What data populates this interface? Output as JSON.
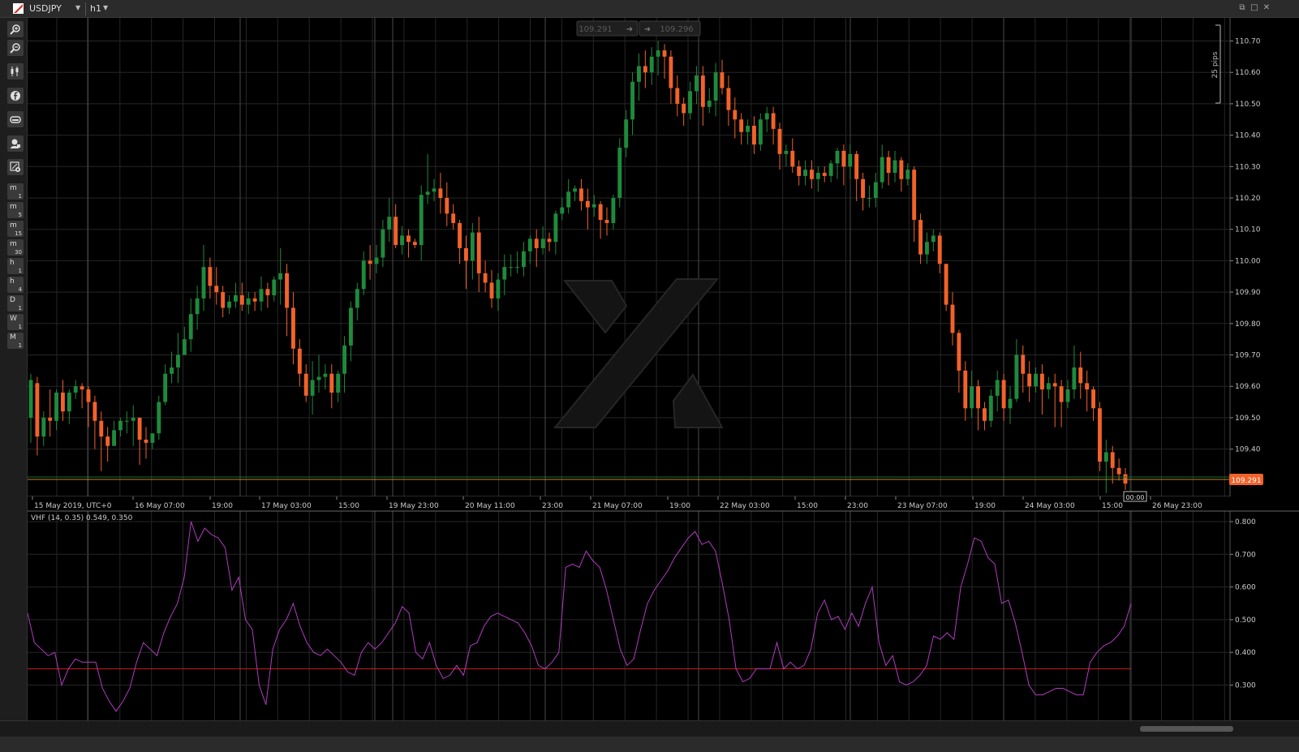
{
  "window": {
    "symbol": "USDJPY",
    "timeframe": "h1"
  },
  "toolbar": {
    "tools": [
      {
        "icon": "zoom-in-icon"
      },
      {
        "icon": "zoom-out-icon"
      },
      {
        "icon": "chart-type-icon"
      },
      {
        "icon": "facebook-icon"
      },
      {
        "icon": "gamepad-icon"
      },
      {
        "icon": "trader-icon"
      },
      {
        "icon": "settings-icon"
      }
    ],
    "timeframes": [
      {
        "main": "m",
        "sub": "1"
      },
      {
        "main": "m",
        "sub": "5"
      },
      {
        "main": "m",
        "sub": "15"
      },
      {
        "main": "m",
        "sub": "30"
      },
      {
        "main": "h",
        "sub": "1"
      },
      {
        "main": "h",
        "sub": "4"
      },
      {
        "main": "D",
        "sub": "1"
      },
      {
        "main": "W",
        "sub": "1"
      },
      {
        "main": "M",
        "sub": "1"
      }
    ]
  },
  "trade": {
    "sell_price": "109.291",
    "buy_price": "109.296"
  },
  "ruler_label": "25 pips",
  "current_price": "109.291",
  "countdown": "00:00",
  "colors": {
    "bull": "#1f8a3c",
    "bear": "#f2622a",
    "vhf": "#b23bc0",
    "level": "#d21e1e",
    "price_line": "#b88a2d",
    "price_tag": "#f2622a"
  },
  "chart_data": [
    {
      "type": "candlestick",
      "title": "USDJPY",
      "ylim": [
        109.25,
        110.74
      ],
      "y_ticks": [
        "110.70",
        "110.60",
        "110.50",
        "110.40",
        "110.30",
        "110.20",
        "110.10",
        "110.00",
        "109.90",
        "109.80",
        "109.70",
        "109.60",
        "109.50",
        "109.40"
      ],
      "x_labels": [
        "15 May 2019, UTC+0",
        "16 May 07:00",
        "19:00",
        "17 May 03:00",
        "15:00",
        "19 May 23:00",
        "20 May 11:00",
        "23:00",
        "21 May 07:00",
        "19:00",
        "22 May 03:00",
        "15:00",
        "23:00",
        "23 May 07:00",
        "19:00",
        "24 May 03:00",
        "15:00",
        "26 May 23:00"
      ],
      "close": [
        109.62,
        109.44,
        109.5,
        109.49,
        109.58,
        109.52,
        109.58,
        109.6,
        109.59,
        109.55,
        109.49,
        109.44,
        109.41,
        109.46,
        109.49,
        109.49,
        109.5,
        109.43,
        109.42,
        109.45,
        109.55,
        109.64,
        109.66,
        109.7,
        109.75,
        109.83,
        109.88,
        109.98,
        109.92,
        109.9,
        109.85,
        109.87,
        109.89,
        109.86,
        109.88,
        109.87,
        109.91,
        109.89,
        109.94,
        109.96,
        109.85,
        109.72,
        109.64,
        109.57,
        109.62,
        109.63,
        109.64,
        109.58,
        109.64,
        109.73,
        109.85,
        109.91,
        110.0,
        109.99,
        110.01,
        110.1,
        110.14,
        110.05,
        110.08,
        110.06,
        110.05,
        110.21,
        110.22,
        110.23,
        110.2,
        110.15,
        110.12,
        110.04,
        110.0,
        110.09,
        109.96,
        109.93,
        109.88,
        109.94,
        109.98,
        109.98,
        109.98,
        110.03,
        110.07,
        110.04,
        110.07,
        110.06,
        110.15,
        110.17,
        110.22,
        110.23,
        110.19,
        110.17,
        110.18,
        110.13,
        110.12,
        110.2,
        110.36,
        110.45,
        110.57,
        110.62,
        110.6,
        110.65,
        110.67,
        110.65,
        110.55,
        110.5,
        110.47,
        110.54,
        110.59,
        110.49,
        110.51,
        110.6,
        110.55,
        110.48,
        110.45,
        110.41,
        110.43,
        110.37,
        110.45,
        110.47,
        110.42,
        110.34,
        110.35,
        110.3,
        110.27,
        110.29,
        110.26,
        110.28,
        110.27,
        110.31,
        110.35,
        110.3,
        110.34,
        110.26,
        110.2,
        110.2,
        110.25,
        110.33,
        110.28,
        110.32,
        110.26,
        110.29,
        110.13,
        110.02,
        110.06,
        110.08,
        109.99,
        109.86,
        109.77,
        109.65,
        109.53,
        109.6,
        109.53,
        109.49,
        109.57,
        109.62,
        109.53,
        109.56,
        109.7,
        109.64,
        109.6,
        109.64,
        109.59,
        109.61,
        109.6,
        109.55,
        109.59,
        109.66,
        109.61,
        109.59,
        109.53,
        109.36,
        109.39,
        109.34,
        109.32,
        109.29
      ],
      "lows": [
        109.42,
        109.38,
        109.41,
        109.44,
        109.46,
        109.49,
        109.48,
        109.56,
        109.53,
        109.47,
        109.4,
        109.33,
        109.36,
        109.42,
        109.44,
        109.45,
        109.41,
        109.35,
        109.37,
        109.4,
        109.43,
        109.54,
        109.61,
        109.61,
        109.71,
        109.71,
        109.78,
        109.84,
        109.88,
        109.86,
        109.82,
        109.83,
        109.85,
        109.84,
        109.83,
        109.84,
        109.84,
        109.85,
        109.87,
        109.86,
        109.76,
        109.67,
        109.6,
        109.55,
        109.51,
        109.58,
        109.59,
        109.53,
        109.55,
        109.58,
        109.68,
        109.81,
        109.89,
        109.94,
        109.96,
        109.98,
        110.06,
        110.04,
        110.02,
        110.01,
        110.04,
        110.0,
        110.18,
        110.19,
        110.15,
        110.11,
        110.1,
        109.99,
        109.91,
        109.94,
        109.9,
        109.9,
        109.85,
        109.84,
        109.89,
        109.95,
        109.96,
        109.95,
        109.99,
        109.98,
        110.02,
        110.03,
        110.02,
        110.13,
        110.15,
        110.19,
        110.16,
        110.1,
        110.14,
        110.07,
        110.08,
        110.1,
        110.17,
        110.33,
        110.4,
        110.51,
        110.55,
        110.56,
        110.59,
        110.58,
        110.5,
        110.46,
        110.43,
        110.45,
        110.5,
        110.43,
        110.47,
        110.46,
        110.53,
        110.43,
        110.39,
        110.37,
        110.37,
        110.34,
        110.35,
        110.41,
        110.37,
        110.29,
        110.3,
        110.28,
        110.24,
        110.24,
        110.23,
        110.22,
        110.25,
        110.25,
        110.26,
        110.24,
        110.26,
        110.19,
        110.16,
        110.17,
        110.17,
        110.23,
        110.24,
        110.25,
        110.22,
        110.24,
        110.06,
        109.99,
        109.99,
        110.03,
        109.96,
        109.84,
        109.73,
        109.58,
        109.49,
        109.5,
        109.46,
        109.46,
        109.47,
        109.52,
        109.49,
        109.48,
        109.55,
        109.58,
        109.55,
        109.58,
        109.51,
        109.56,
        109.47,
        109.47,
        109.53,
        109.56,
        109.56,
        109.52,
        109.49,
        109.33,
        109.26,
        109.29,
        109.3,
        109.27
      ],
      "opens": [
        109.5,
        109.61,
        109.44,
        109.5,
        109.49,
        109.58,
        109.52,
        109.58,
        109.6,
        109.59,
        109.55,
        109.49,
        109.44,
        109.41,
        109.46,
        109.49,
        109.49,
        109.5,
        109.43,
        109.42,
        109.45,
        109.55,
        109.64,
        109.66,
        109.7,
        109.75,
        109.83,
        109.88,
        109.98,
        109.92,
        109.9,
        109.85,
        109.87,
        109.89,
        109.86,
        109.88,
        109.87,
        109.91,
        109.89,
        109.94,
        109.96,
        109.85,
        109.72,
        109.64,
        109.57,
        109.62,
        109.63,
        109.64,
        109.58,
        109.64,
        109.73,
        109.85,
        109.91,
        110.0,
        109.99,
        110.01,
        110.1,
        110.14,
        110.05,
        110.08,
        110.06,
        110.05,
        110.21,
        110.22,
        110.23,
        110.2,
        110.15,
        110.12,
        110.04,
        110.0,
        110.09,
        109.96,
        109.93,
        109.88,
        109.94,
        109.98,
        109.98,
        109.98,
        110.03,
        110.07,
        110.04,
        110.07,
        110.06,
        110.15,
        110.17,
        110.22,
        110.23,
        110.19,
        110.17,
        110.18,
        110.13,
        110.12,
        110.2,
        110.36,
        110.45,
        110.57,
        110.62,
        110.6,
        110.65,
        110.67,
        110.65,
        110.55,
        110.5,
        110.47,
        110.54,
        110.59,
        110.49,
        110.51,
        110.6,
        110.55,
        110.48,
        110.45,
        110.41,
        110.43,
        110.37,
        110.45,
        110.47,
        110.42,
        110.34,
        110.35,
        110.3,
        110.27,
        110.29,
        110.26,
        110.28,
        110.27,
        110.31,
        110.35,
        110.3,
        110.34,
        110.26,
        110.2,
        110.2,
        110.25,
        110.33,
        110.28,
        110.32,
        110.26,
        110.29,
        110.13,
        110.02,
        110.06,
        110.08,
        109.99,
        109.86,
        109.77,
        109.65,
        109.53,
        109.6,
        109.53,
        109.49,
        109.57,
        109.62,
        109.53,
        109.56,
        109.7,
        109.64,
        109.6,
        109.64,
        109.59,
        109.61,
        109.6,
        109.55,
        109.59,
        109.66,
        109.61,
        109.59,
        109.53,
        109.36,
        109.39,
        109.34,
        109.32
      ],
      "highs": [
        109.64,
        109.63,
        109.52,
        109.59,
        109.59,
        109.62,
        109.59,
        109.62,
        109.61,
        109.6,
        109.57,
        109.52,
        109.47,
        109.49,
        109.5,
        109.52,
        109.54,
        109.5,
        109.47,
        109.45,
        109.57,
        109.67,
        109.71,
        109.77,
        109.79,
        109.88,
        109.92,
        110.05,
        110.01,
        109.98,
        109.92,
        109.89,
        109.93,
        109.93,
        109.9,
        109.9,
        109.95,
        109.93,
        109.95,
        110.04,
        109.99,
        109.9,
        109.75,
        109.67,
        109.68,
        109.7,
        109.67,
        109.67,
        109.65,
        109.76,
        109.87,
        109.93,
        110.03,
        110.05,
        110.05,
        110.13,
        110.2,
        110.18,
        110.11,
        110.1,
        110.07,
        110.24,
        110.34,
        110.26,
        110.28,
        110.25,
        110.18,
        110.13,
        110.08,
        110.12,
        110.14,
        110.0,
        109.97,
        109.96,
        110.02,
        110.02,
        110.03,
        110.06,
        110.08,
        110.1,
        110.11,
        110.09,
        110.16,
        110.2,
        110.26,
        110.24,
        110.26,
        110.23,
        110.21,
        110.19,
        110.17,
        110.21,
        110.39,
        110.48,
        110.6,
        110.66,
        110.67,
        110.68,
        110.7,
        110.69,
        110.67,
        110.59,
        110.52,
        110.57,
        110.62,
        110.62,
        110.55,
        110.63,
        110.64,
        110.59,
        110.52,
        110.47,
        110.45,
        110.46,
        110.47,
        110.49,
        110.49,
        110.44,
        110.37,
        110.39,
        110.32,
        110.32,
        110.32,
        110.3,
        110.3,
        110.32,
        110.36,
        110.37,
        110.37,
        110.35,
        110.28,
        110.24,
        110.28,
        110.37,
        110.35,
        110.35,
        110.33,
        110.31,
        110.3,
        110.15,
        110.09,
        110.1,
        110.09,
        109.99,
        109.9,
        109.78,
        109.68,
        109.65,
        109.62,
        109.55,
        109.59,
        109.65,
        109.64,
        109.6,
        109.75,
        109.73,
        109.68,
        109.66,
        109.67,
        109.63,
        109.64,
        109.62,
        109.62,
        109.73,
        109.71,
        109.65,
        109.6,
        109.55,
        109.43,
        109.41,
        109.37,
        109.34
      ]
    },
    {
      "type": "line",
      "title": "VHF (14, 0.35) 0.549, 0.350",
      "ylim": [
        0.2,
        0.81
      ],
      "y_ticks": [
        "0.800",
        "0.700",
        "0.600",
        "0.500",
        "0.400",
        "0.300"
      ],
      "level": 0.35,
      "series": [
        {
          "name": "VHF",
          "values": [
            0.52,
            0.43,
            0.41,
            0.39,
            0.4,
            0.3,
            0.35,
            0.38,
            0.37,
            0.37,
            0.37,
            0.29,
            0.25,
            0.22,
            0.25,
            0.29,
            0.37,
            0.43,
            0.41,
            0.39,
            0.46,
            0.51,
            0.55,
            0.63,
            0.8,
            0.74,
            0.78,
            0.76,
            0.75,
            0.72,
            0.59,
            0.63,
            0.5,
            0.47,
            0.3,
            0.24,
            0.41,
            0.47,
            0.5,
            0.55,
            0.48,
            0.43,
            0.4,
            0.39,
            0.41,
            0.39,
            0.37,
            0.34,
            0.33,
            0.4,
            0.43,
            0.41,
            0.43,
            0.46,
            0.49,
            0.54,
            0.52,
            0.4,
            0.38,
            0.43,
            0.36,
            0.32,
            0.33,
            0.36,
            0.33,
            0.42,
            0.43,
            0.48,
            0.51,
            0.52,
            0.51,
            0.5,
            0.49,
            0.46,
            0.42,
            0.36,
            0.35,
            0.37,
            0.4,
            0.66,
            0.67,
            0.66,
            0.71,
            0.68,
            0.66,
            0.59,
            0.5,
            0.41,
            0.36,
            0.38,
            0.47,
            0.55,
            0.59,
            0.62,
            0.65,
            0.69,
            0.72,
            0.75,
            0.77,
            0.73,
            0.74,
            0.71,
            0.61,
            0.5,
            0.35,
            0.31,
            0.32,
            0.35,
            0.35,
            0.35,
            0.43,
            0.35,
            0.37,
            0.35,
            0.36,
            0.41,
            0.52,
            0.56,
            0.5,
            0.51,
            0.47,
            0.52,
            0.48,
            0.55,
            0.6,
            0.43,
            0.36,
            0.39,
            0.31,
            0.3,
            0.31,
            0.33,
            0.36,
            0.45,
            0.44,
            0.46,
            0.44,
            0.6,
            0.67,
            0.75,
            0.74,
            0.69,
            0.67,
            0.55,
            0.56,
            0.49,
            0.4,
            0.3,
            0.27,
            0.27,
            0.28,
            0.29,
            0.29,
            0.28,
            0.27,
            0.27,
            0.37,
            0.4,
            0.42,
            0.43,
            0.45,
            0.48,
            0.549
          ]
        }
      ]
    }
  ]
}
